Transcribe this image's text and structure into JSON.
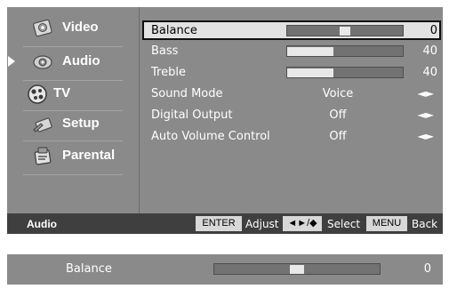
{
  "sidebar": {
    "items": [
      {
        "label": "Video",
        "icon": "video-icon",
        "selected": false
      },
      {
        "label": "Audio",
        "icon": "audio-icon",
        "selected": true
      },
      {
        "label": "TV",
        "icon": "tv-icon",
        "selected": false
      },
      {
        "label": "Setup",
        "icon": "setup-icon",
        "selected": false
      },
      {
        "label": "Parental",
        "icon": "parental-icon",
        "selected": false
      }
    ]
  },
  "audio_menu": {
    "rows": [
      {
        "label": "Balance",
        "type": "slider",
        "value": "0",
        "level_percent": 50,
        "selected": true
      },
      {
        "label": "Bass",
        "type": "slider",
        "value": "40",
        "level_percent": 40
      },
      {
        "label": "Treble",
        "type": "slider",
        "value": "40",
        "level_percent": 40
      },
      {
        "label": "Sound Mode",
        "type": "option",
        "value": "Voice"
      },
      {
        "label": "Digital Output",
        "type": "option",
        "value": "Off"
      },
      {
        "label": "Auto Volume Control",
        "type": "option",
        "value": "Off"
      }
    ],
    "option_arrows": "◄►"
  },
  "status_bar": {
    "section": "Audio",
    "enter_key": "ENTER",
    "enter_action": "Adjust",
    "nav_key": "◄►/◆",
    "nav_action": "Select",
    "menu_key": "MENU",
    "menu_action": "Back"
  },
  "balance_bar": {
    "label": "Balance",
    "value": "0",
    "level_percent": 50
  },
  "colors": {
    "panel": "#8a8a8a",
    "status_bar": "#3f3f3f",
    "highlight": "#e2e2e2",
    "text": "#ffffff"
  }
}
